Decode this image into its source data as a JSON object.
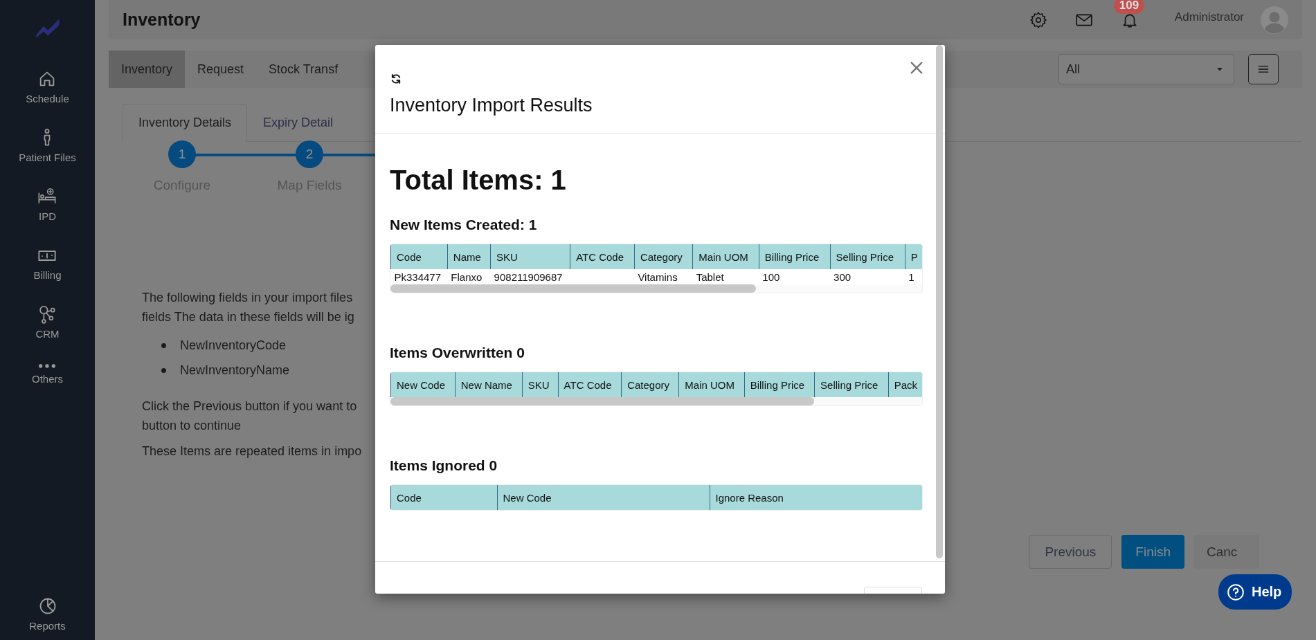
{
  "sidebar": {
    "items": [
      {
        "label": "Schedule",
        "kind": "home"
      },
      {
        "label": "Patient Files",
        "kind": "person"
      },
      {
        "label": "IPD",
        "kind": "bed"
      },
      {
        "label": "Billing",
        "kind": "money"
      },
      {
        "label": "CRM",
        "kind": "nodes"
      },
      {
        "label": "Others",
        "kind": "dots"
      }
    ],
    "bottom": {
      "label": "Reports",
      "kind": "chart"
    }
  },
  "header": {
    "title": "Inventory",
    "notification_count": "109",
    "user": "Administrator"
  },
  "subnav": {
    "tabs": [
      {
        "label": "Inventory",
        "selected": true
      },
      {
        "label": "Request",
        "selected": false
      },
      {
        "label": "Stock Transf",
        "selected": false
      }
    ],
    "filter": {
      "value": "All"
    }
  },
  "detail_tabs": [
    {
      "label": "Inventory Details",
      "selected": true
    },
    {
      "label": "Expiry Detail",
      "selected": false
    }
  ],
  "stepper": [
    {
      "number": "1",
      "label": "Configure"
    },
    {
      "number": "2",
      "label": "Map Fields"
    }
  ],
  "notice": {
    "intro": [
      "The following fields in your import files",
      "fields The data in these fields will be ig"
    ],
    "fields": [
      "NewInventoryCode",
      "NewInventoryName"
    ],
    "instruction": [
      "Click the Previous button if you want to",
      "button to continue"
    ],
    "repeated_note": "These Items are repeated items in impo"
  },
  "actions": [
    {
      "label": "Previous",
      "kind": "secondary"
    },
    {
      "label": "Finish",
      "kind": "primary"
    },
    {
      "label": "Canc",
      "kind": "light"
    }
  ],
  "help": {
    "label": "Help"
  },
  "modal": {
    "title": "Inventory Import Results",
    "total": "Total Items: 1",
    "sections": [
      {
        "heading": "New Items Created: 1",
        "scroll": true,
        "columns": [
          "Code",
          "Name",
          "SKU",
          "ATC Code",
          "Category",
          "Main UOM",
          "Billing Price",
          "Selling Price",
          "P"
        ],
        "rows": [
          [
            "Pk334477",
            "Flanxo",
            "908211909687",
            "",
            "Vitamins",
            "Tablet",
            "100",
            "300",
            "1"
          ]
        ]
      },
      {
        "heading": "Items Overwritten 0",
        "scroll": true,
        "columns": [
          "New Code",
          "New Name",
          "SKU",
          "ATC Code",
          "Category",
          "Main UOM",
          "Billing Price",
          "Selling Price",
          "Pack"
        ]
      },
      {
        "heading": "Items Ignored 0",
        "scroll": false,
        "columns": [
          "Code",
          "New Code",
          "Ignore Reason"
        ]
      }
    ]
  }
}
